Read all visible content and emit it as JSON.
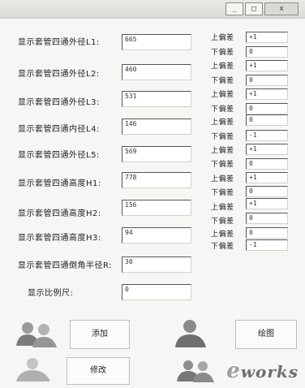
{
  "window": {
    "controls": {
      "minimize": "_",
      "maximize": "□",
      "close": "x"
    }
  },
  "fields": [
    {
      "label": "显示套管四通外径L1:",
      "value": "665",
      "upper_label": "上偏差",
      "upper_value": "+1",
      "lower_label": "下偏差",
      "lower_value": "0"
    },
    {
      "label": "显示套管四通外径L2:",
      "value": "460",
      "upper_label": "上偏差",
      "upper_value": "+1",
      "lower_label": "下偏差",
      "lower_value": "0"
    },
    {
      "label": "显示套管四通外径L3:",
      "value": "531",
      "upper_label": "上偏差",
      "upper_value": "+1",
      "lower_label": "下偏差",
      "lower_value": "0"
    },
    {
      "label": "显示套管四通内径L4:",
      "value": "146",
      "upper_label": "上偏差",
      "upper_value": "0",
      "lower_label": "下偏差",
      "lower_value": "-1"
    },
    {
      "label": "显示套管四通外径L5:",
      "value": "569",
      "upper_label": "上偏差",
      "upper_value": "+1",
      "lower_label": "下偏差",
      "lower_value": "0"
    },
    {
      "label": "显示套管四通高度H1:",
      "value": "778",
      "upper_label": "上偏差",
      "upper_value": "+1",
      "lower_label": "下偏差",
      "lower_value": "0"
    },
    {
      "label": "显示套管四通高度H2:",
      "value": "156",
      "upper_label": "上偏差",
      "upper_value": "+1",
      "lower_label": "下偏差",
      "lower_value": "0"
    },
    {
      "label": "显示套管四通高度H3:",
      "value": "94",
      "upper_label": "上偏差",
      "upper_value": "0",
      "lower_label": "下偏差",
      "lower_value": "-1"
    }
  ],
  "radius": {
    "label": "显示套管四通倒角半径R:",
    "value": "30"
  },
  "scale": {
    "label": "显示比例尺:",
    "value": "0"
  },
  "buttons": {
    "add": "添加",
    "draw": "绘图",
    "modify": "修改"
  },
  "watermark": {
    "letter": "e",
    "text": "works"
  },
  "icons": {
    "add": "users-icon",
    "draw": "user-icon",
    "modify": "user-icon",
    "extra": "users-icon"
  }
}
